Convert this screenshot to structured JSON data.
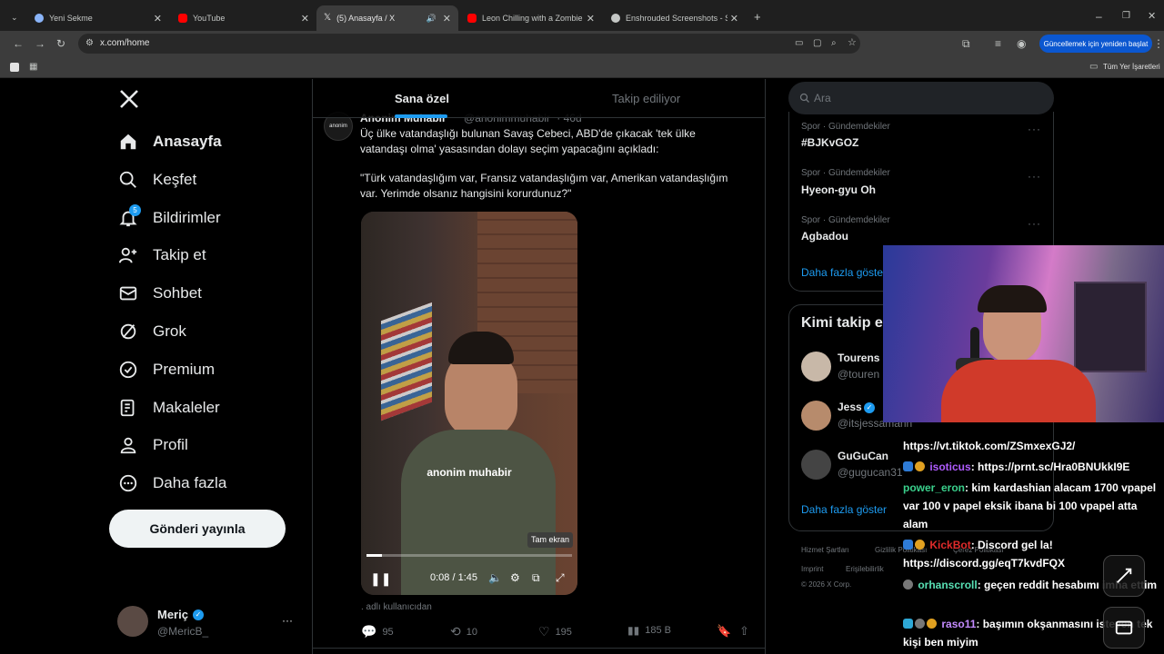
{
  "browser": {
    "tabs": [
      {
        "label": "Yeni Sekme",
        "active": false,
        "favicon_color": "#8ab4f8"
      },
      {
        "label": "YouTube",
        "active": false,
        "favicon_color": "#ff0000"
      },
      {
        "label": "(5) Anasayfa / X",
        "active": true,
        "favicon_color": "#e7e9ea"
      },
      {
        "label": "Leon Chilling with a Zombie - R",
        "active": false,
        "favicon_color": "#ff0000"
      },
      {
        "label": "Enshrouded Screenshots - Stea",
        "active": false,
        "favicon_color": "#c4c7c5"
      }
    ],
    "url": "x.com/home",
    "update_button": "Güncellemek için yeniden başlat",
    "bookmarks_label": "Tüm Yer İşaretleri"
  },
  "sidebar": {
    "items": [
      {
        "label": "Anasayfa",
        "icon": "home-icon"
      },
      {
        "label": "Keşfet",
        "icon": "search-icon"
      },
      {
        "label": "Bildirimler",
        "icon": "bell-icon",
        "badge": "5"
      },
      {
        "label": "Takip et",
        "icon": "add-user-icon"
      },
      {
        "label": "Sohbet",
        "icon": "mail-icon"
      },
      {
        "label": "Grok",
        "icon": "grok-icon"
      },
      {
        "label": "Premium",
        "icon": "verified-icon"
      },
      {
        "label": "Makaleler",
        "icon": "article-icon"
      },
      {
        "label": "Profil",
        "icon": "person-icon"
      },
      {
        "label": "Daha fazla",
        "icon": "more-icon"
      }
    ],
    "post_button": "Gönderi yayınla",
    "account": {
      "name": "Meriç",
      "handle": "@MericB_",
      "more": "···"
    }
  },
  "feed": {
    "tabs": [
      "Sana özel",
      "Takip ediliyor"
    ],
    "tweet": {
      "author": "Anonim Muhabir",
      "handle": "@anonimmuhabir",
      "time": "· 46d",
      "avatar_text": "anonim",
      "text_line1": "Üç ülke vatandaşlığı bulunan Savaş Cebeci, ABD'de çıkacak 'tek ülke",
      "text_line2": "vatandaşı olma' yasasından dolayı seçim yapacağını açıkladı:",
      "quote_line1": "\"Türk vatandaşlığım var, Fransız vatandaşlığım var, Amerikan vatandaşlığım",
      "quote_line2": "var. Yerimde olsanız hangisini korurdunuz?\"",
      "video": {
        "watermark": "anonim muhabir",
        "tooltip": "Tam ekran",
        "time": "0:08 / 1:45",
        "progress": 0.076
      },
      "attribution": ". adlı kullanıcıdan",
      "replies": "95",
      "reposts": "10",
      "likes": "195",
      "views": "185 B"
    }
  },
  "right": {
    "search_placeholder": "Ara",
    "trends": [
      {
        "category": "Spor · Gündemdekiler",
        "name": "#BJKvGOZ"
      },
      {
        "category": "Spor · Gündemdekiler",
        "name": "Hyeon-gyu Oh"
      },
      {
        "category": "Spor · Gündemdekiler",
        "name": "Agbadou"
      }
    ],
    "trends_more": "Daha fazla göster",
    "wtf_title": "Kimi takip e",
    "wtf": [
      {
        "name": "Tourens",
        "handle": "@touren"
      },
      {
        "name": "Jess",
        "handle": "@itsjessamann"
      },
      {
        "name": "GuGuCan",
        "handle": "@gugucan31"
      }
    ],
    "wtf_more": "Daha fazla göster",
    "footer": {
      "links": [
        "Hizmet Şartları",
        "Gizlilik Politikası",
        "Çerez Politikası",
        "Imprint",
        "Erişilebilirlik"
      ],
      "copyright": "© 2026 X Corp."
    }
  },
  "stream": {
    "chat": [
      {
        "user": "",
        "text": "https://vt.tiktok.com/ZSmxexGJ2/",
        "user_color": "#ffffff"
      },
      {
        "user": "isoticus",
        "text": ": https://prnt.sc/Hra0BNUkkI9E",
        "user_color": "#b05cff"
      },
      {
        "user": "power_eron",
        "text": ": kim kardashian alacam 1700 vpapel var 100 v papel eksik ibana bi 100 vpapel atta alam",
        "user_color": "#3ad08c"
      },
      {
        "user": "KickBot",
        "text": ": Discord gel la! https://discord.gg/eqT7kvdFQX",
        "user_color": "#e02b2b"
      },
      {
        "user": "orhanscroll",
        "text": ": geçen reddit hesabımı imha ettim",
        "user_color": "#58e0b4"
      },
      {
        "user": "raso11",
        "text": ": başımın okşanmasını isteyen tek kişi ben miyim",
        "user_color": "#c48bff"
      }
    ]
  }
}
